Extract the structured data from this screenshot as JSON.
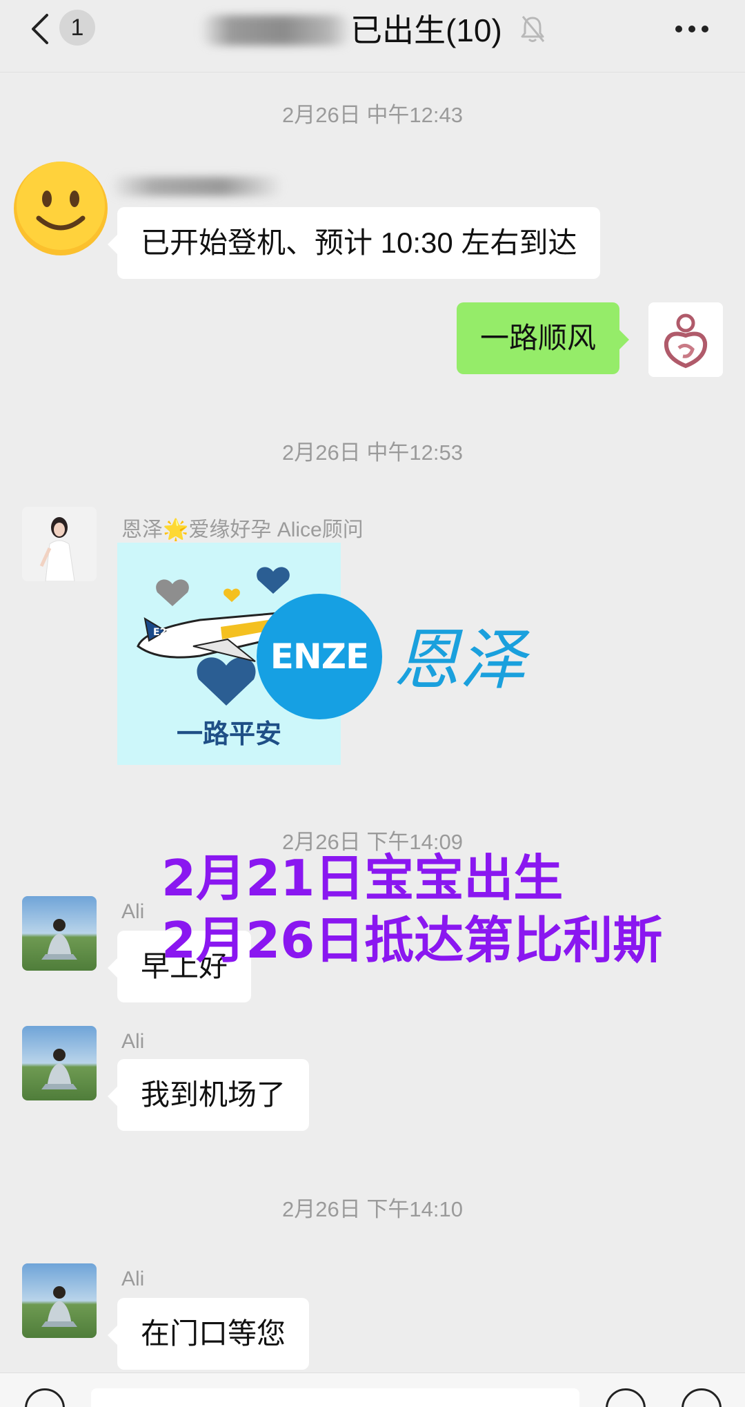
{
  "header": {
    "back_count": "1",
    "title": "已出生(10)"
  },
  "messages": {
    "m1": {
      "text": "已开始登机、预计 10:30 左右到达"
    },
    "m2": {
      "text": "一路顺风"
    },
    "m3": {
      "sender": "恩泽🌟爱缘好孕 Alice顾问",
      "sticker_caption": "一路平安",
      "sticker_tag": "E2"
    },
    "m4": {
      "sender": "Ali",
      "text": "早上好"
    },
    "m5": {
      "sender": "Ali",
      "text": "我到机场了"
    },
    "m6": {
      "sender": "Ali",
      "text": "在门口等您"
    }
  },
  "timestamps": {
    "t1": "2月26日 中午12:43",
    "t2": "2月26日 中午12:53",
    "t3": "2月26日 下午14:09",
    "t4": "2月26日 下午14:10"
  },
  "watermark": {
    "logo_text": "ENZE",
    "logo_chinese": "恩泽"
  },
  "overlay": {
    "line1": "2月21日宝宝出生",
    "line2": "2月26日抵达第比利斯"
  },
  "colors": {
    "background": "#ededed",
    "bubble_other": "#ffffff",
    "bubble_mine": "#95ec69",
    "overlay_text": "#8a17f0",
    "logo_blue": "#16a0e3"
  }
}
